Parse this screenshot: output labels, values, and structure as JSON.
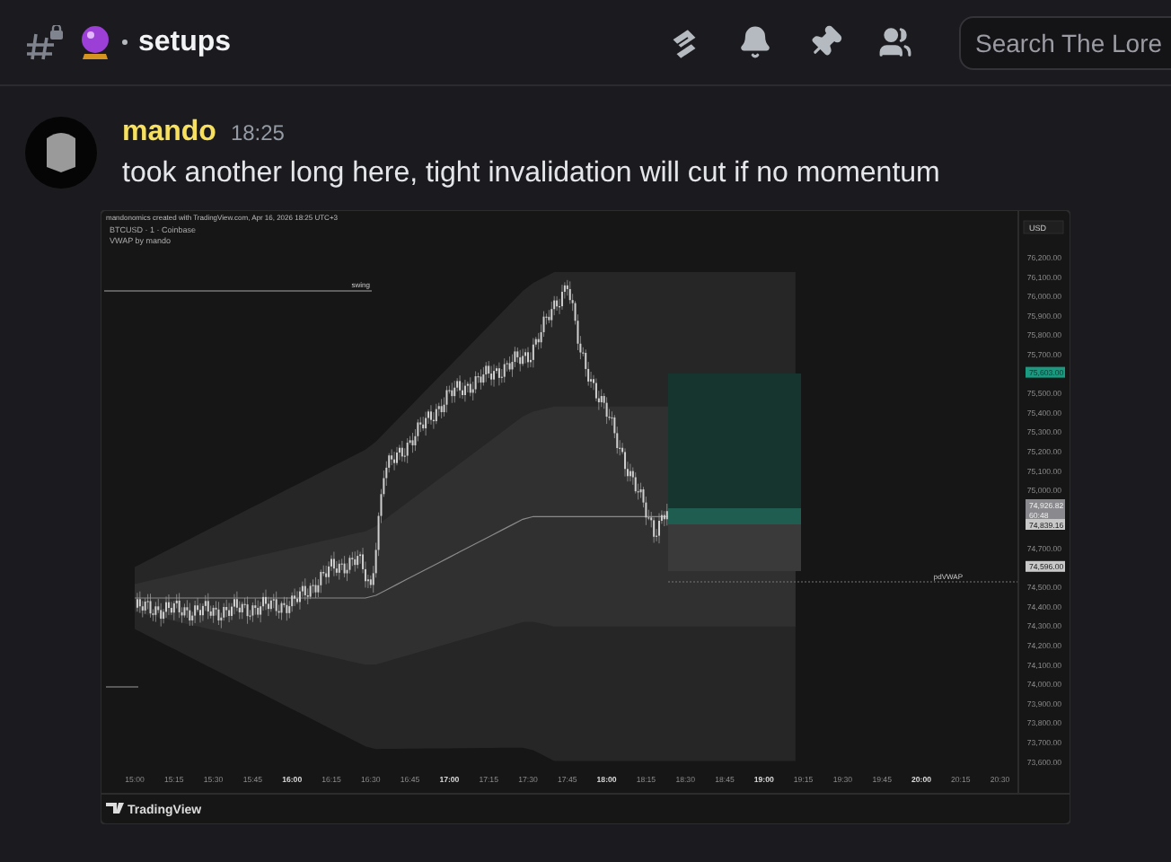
{
  "channel": {
    "name": "setups"
  },
  "search": {
    "placeholder": "Search The Lore"
  },
  "message": {
    "author": "mando",
    "time": "18:25",
    "text": "took another long here, tight invalidation will cut if no momentum",
    "attachment": {
      "watermark_line": "mandonomics created with TradingView.com, Apr 16, 2026 18:25 UTC+3",
      "symbol": "BTCUSD · 1 · Coinbase",
      "indicator": "VWAP by mando",
      "level_labels": [
        {
          "text": "swing"
        },
        {
          "text": "pdVWAP"
        }
      ],
      "unit": "USD",
      "price_labels": [
        {
          "text": "76,200.00",
          "kind": "plain"
        },
        {
          "text": "76,100.00",
          "kind": "plain"
        },
        {
          "text": "76,000.00",
          "kind": "plain"
        },
        {
          "text": "75,900.00",
          "kind": "plain"
        },
        {
          "text": "75,800.00",
          "kind": "plain"
        },
        {
          "text": "75,700.00",
          "kind": "plain"
        },
        {
          "text": "75,603.00",
          "kind": "target"
        },
        {
          "text": "75,500.00",
          "kind": "plain"
        },
        {
          "text": "75,400.00",
          "kind": "plain"
        },
        {
          "text": "75,300.00",
          "kind": "plain"
        },
        {
          "text": "75,200.00",
          "kind": "plain"
        },
        {
          "text": "75,100.00",
          "kind": "plain"
        },
        {
          "text": "75,000.00",
          "kind": "plain"
        },
        {
          "text": "74,926.82",
          "kind": "last"
        },
        {
          "text": "60:48",
          "kind": "last"
        },
        {
          "text": "74,839.16",
          "kind": "entry"
        },
        {
          "text": "74,700.00",
          "kind": "plain"
        },
        {
          "text": "74,596.00",
          "kind": "entry"
        },
        {
          "text": "74,500.00",
          "kind": "plain"
        },
        {
          "text": "74,400.00",
          "kind": "plain"
        },
        {
          "text": "74,300.00",
          "kind": "plain"
        },
        {
          "text": "74,200.00",
          "kind": "plain"
        },
        {
          "text": "74,100.00",
          "kind": "plain"
        },
        {
          "text": "74,000.00",
          "kind": "plain"
        },
        {
          "text": "73,900.00",
          "kind": "plain"
        },
        {
          "text": "73,800.00",
          "kind": "plain"
        },
        {
          "text": "73,700.00",
          "kind": "plain"
        },
        {
          "text": "73,600.00",
          "kind": "plain"
        }
      ],
      "time_labels": [
        {
          "text": "15:00",
          "bold": false
        },
        {
          "text": "15:15",
          "bold": false
        },
        {
          "text": "15:30",
          "bold": false
        },
        {
          "text": "15:45",
          "bold": false
        },
        {
          "text": "16:00",
          "bold": true
        },
        {
          "text": "16:15",
          "bold": false
        },
        {
          "text": "16:30",
          "bold": false
        },
        {
          "text": "16:45",
          "bold": false
        },
        {
          "text": "17:00",
          "bold": true
        },
        {
          "text": "17:15",
          "bold": false
        },
        {
          "text": "17:30",
          "bold": false
        },
        {
          "text": "17:45",
          "bold": false
        },
        {
          "text": "18:00",
          "bold": true
        },
        {
          "text": "18:15",
          "bold": false
        },
        {
          "text": "18:30",
          "bold": false
        },
        {
          "text": "18:45",
          "bold": false
        },
        {
          "text": "19:00",
          "bold": true
        },
        {
          "text": "19:15",
          "bold": false
        },
        {
          "text": "19:30",
          "bold": false
        },
        {
          "text": "19:45",
          "bold": false
        },
        {
          "text": "20:00",
          "bold": true
        },
        {
          "text": "20:15",
          "bold": false
        },
        {
          "text": "20:30",
          "bold": false
        }
      ],
      "brand": "TradingView"
    }
  }
}
